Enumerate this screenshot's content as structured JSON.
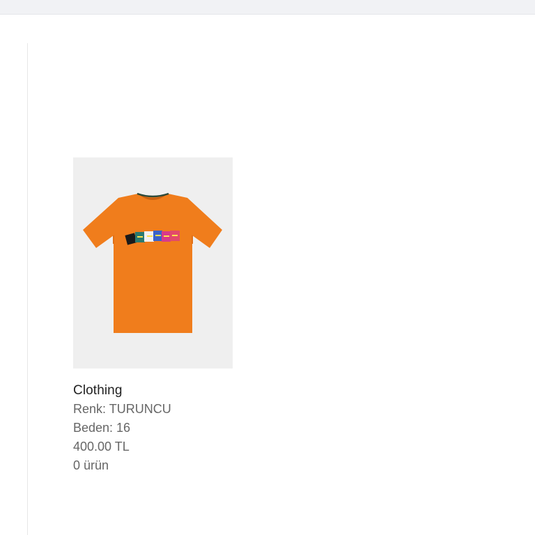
{
  "product": {
    "name": "Clothing",
    "color_line": "Renk: TURUNCU",
    "size_line": "Beden: 16",
    "price_line": "400.00 TL",
    "count_line": "0 ürün",
    "image_icon": "orange-tshirt-icon"
  },
  "colors": {
    "shirt": "#f07d1c",
    "image_bg": "#efefef",
    "title_text": "#222222",
    "meta_text": "#666666"
  }
}
